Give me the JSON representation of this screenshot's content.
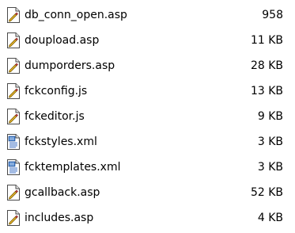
{
  "files": [
    {
      "name": "db_conn_open.asp",
      "size": "958",
      "icon": "asp-script-file-icon"
    },
    {
      "name": "doupload.asp",
      "size": "11 KB",
      "icon": "asp-script-file-icon"
    },
    {
      "name": "dumporders.asp",
      "size": "28 KB",
      "icon": "asp-script-file-icon"
    },
    {
      "name": "fckconfig.js",
      "size": "13 KB",
      "icon": "js-script-file-icon"
    },
    {
      "name": "fckeditor.js",
      "size": "9 KB",
      "icon": "js-script-file-icon"
    },
    {
      "name": "fckstyles.xml",
      "size": "3 KB",
      "icon": "xml-document-icon"
    },
    {
      "name": "fcktemplates.xml",
      "size": "3 KB",
      "icon": "xml-document-icon"
    },
    {
      "name": "gcallback.asp",
      "size": "52 KB",
      "icon": "asp-script-file-icon"
    },
    {
      "name": "includes.asp",
      "size": "4 KB",
      "icon": "asp-script-file-icon"
    }
  ]
}
